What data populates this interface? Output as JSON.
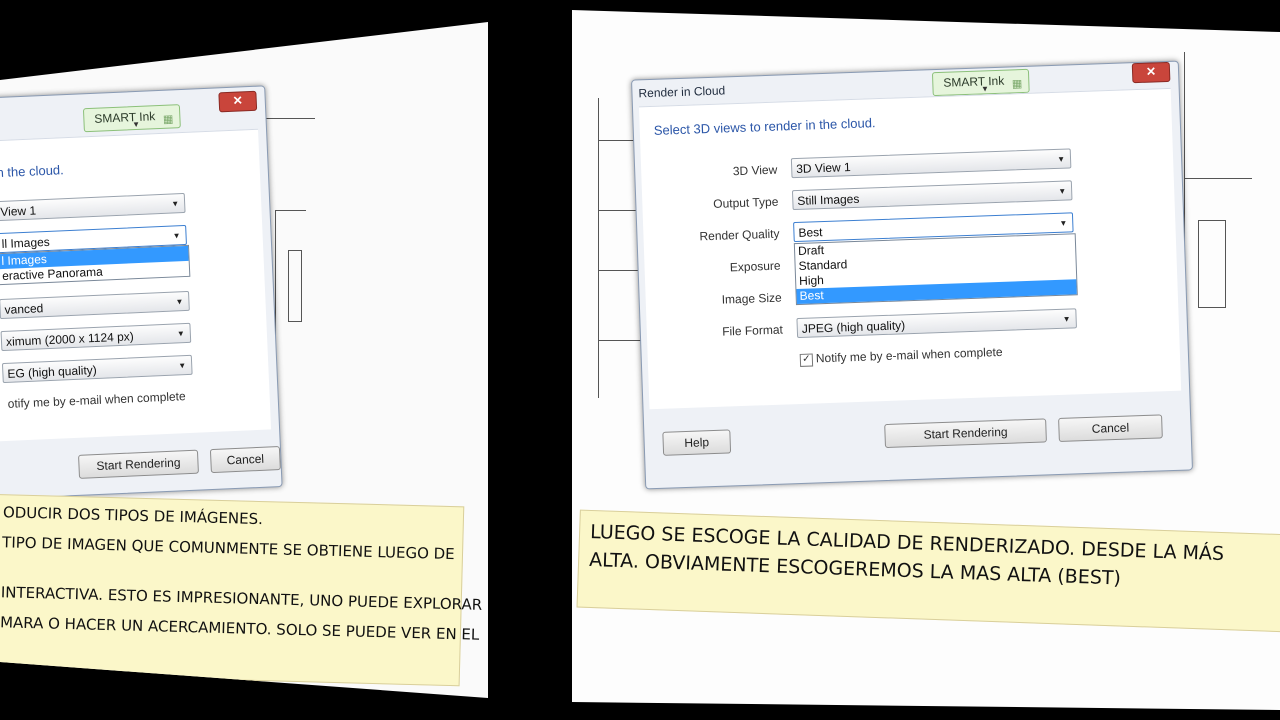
{
  "left": {
    "dialog": {
      "close_label": "✕",
      "smart_ink": "SMART Ink",
      "prompt": "in the cloud.",
      "combos": [
        {
          "value": "View 1"
        },
        {
          "value": "ll Images"
        },
        {
          "value": "vanced"
        },
        {
          "value": "ximum (2000 x 1124 px)"
        },
        {
          "value": "EG (high quality)"
        }
      ],
      "dropdown_options": [
        "l Images",
        "eractive Panorama"
      ],
      "checkbox_label": "otify me by e-mail when complete",
      "start_button": "Start Rendering",
      "cancel_button": "Cancel"
    },
    "caption": {
      "lines": [
        "ODUCIR DOS TIPOS DE IMÁGENES.",
        "TIPO DE IMAGEN QUE COMUNMENTE SE OBTIENE LUEGO DE",
        "INTERACTIVA. ESTO ES IMPRESIONANTE, UNO PUEDE EXPLORAR",
        "MARA O HACER UN ACERCAMIENTO. SOLO SE PUEDE VER EN EL"
      ],
      "reflection": "MARA O HACER UN ACERCAMIENTO"
    }
  },
  "right": {
    "dialog": {
      "title": "Render in Cloud",
      "close_label": "✕",
      "smart_ink": "SMART Ink",
      "prompt": "Select 3D views to render in the cloud.",
      "fields": [
        {
          "label": "3D View",
          "value": "3D View 1"
        },
        {
          "label": "Output Type",
          "value": "Still Images"
        },
        {
          "label": "Render Quality",
          "value": "Best"
        },
        {
          "label": "Exposure",
          "value": ""
        },
        {
          "label": "Image Size",
          "value": ""
        },
        {
          "label": "File Format",
          "value": "JPEG (high quality)"
        }
      ],
      "quality_options": [
        "Draft",
        "Standard",
        "High",
        "Best"
      ],
      "selected_quality": "Best",
      "checkbox_label": "Notify me by e-mail when complete",
      "checkbox_checked": "✓",
      "help_button": "Help",
      "start_button": "Start Rendering",
      "cancel_button": "Cancel"
    },
    "caption": {
      "lines": [
        "LUEGO SE ESCOGE LA CALIDAD DE RENDERIZADO. DESDE LA MÁS",
        "ALTA. OBVIAMENTE ESCOGEREMOS LA MAS ALTA (BEST)"
      ]
    }
  }
}
